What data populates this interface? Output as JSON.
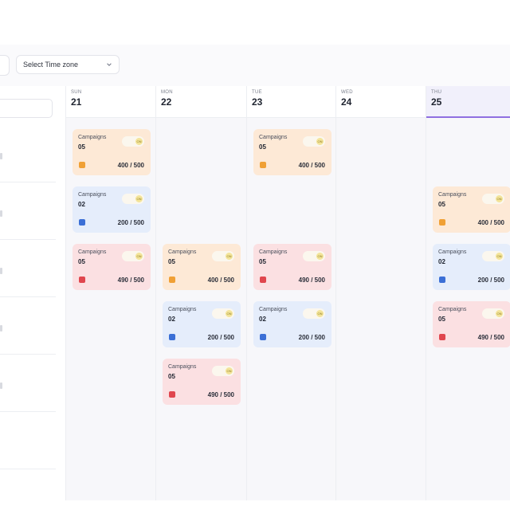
{
  "toolbar": {
    "timezone_placeholder": "Select Time zone"
  },
  "days": [
    {
      "dow": "SUN",
      "num": "21",
      "active": false
    },
    {
      "dow": "MON",
      "num": "22",
      "active": false
    },
    {
      "dow": "TUE",
      "num": "23",
      "active": false
    },
    {
      "dow": "WED",
      "num": "24",
      "active": false
    },
    {
      "dow": "THU",
      "num": "25",
      "active": true
    }
  ],
  "cards": [
    {
      "day": 0,
      "slot": 0,
      "color": "orange",
      "title": "Campaigns",
      "count": "05",
      "ratio": "400 / 500"
    },
    {
      "day": 0,
      "slot": 1,
      "color": "blue",
      "title": "Campaigns",
      "count": "02",
      "ratio": "200 / 500"
    },
    {
      "day": 0,
      "slot": 2,
      "color": "red",
      "title": "Campaigns",
      "count": "05",
      "ratio": "490 / 500"
    },
    {
      "day": 1,
      "slot": 2,
      "color": "orange",
      "title": "Campaigns",
      "count": "05",
      "ratio": "400 / 500"
    },
    {
      "day": 1,
      "slot": 3,
      "color": "blue",
      "title": "Campaigns",
      "count": "02",
      "ratio": "200 / 500"
    },
    {
      "day": 1,
      "slot": 4,
      "color": "red",
      "title": "Campaigns",
      "count": "05",
      "ratio": "490 / 500"
    },
    {
      "day": 2,
      "slot": 0,
      "color": "orange",
      "title": "Campaigns",
      "count": "05",
      "ratio": "400 / 500"
    },
    {
      "day": 2,
      "slot": 2,
      "color": "red",
      "title": "Campaigns",
      "count": "05",
      "ratio": "490 / 500"
    },
    {
      "day": 2,
      "slot": 3,
      "color": "blue",
      "title": "Campaigns",
      "count": "02",
      "ratio": "200 / 500"
    },
    {
      "day": 4,
      "slot": 1,
      "color": "orange",
      "title": "Campaigns",
      "count": "05",
      "ratio": "400 / 500"
    },
    {
      "day": 4,
      "slot": 2,
      "color": "blue",
      "title": "Campaigns",
      "count": "02",
      "ratio": "200 / 500"
    },
    {
      "day": 4,
      "slot": 3,
      "color": "red",
      "title": "Campaigns",
      "count": "05",
      "ratio": "490 / 500"
    }
  ],
  "toggle_label": "ON",
  "colors": {
    "accent": "#8f6fe0",
    "orange": "#fde9d6",
    "blue": "#e5edfb",
    "red": "#fbe0e2"
  },
  "icons": {
    "timezone_chevron": "chevron-down-icon",
    "card_icon": "campaign-icon",
    "toggle": "toggle-switch"
  }
}
